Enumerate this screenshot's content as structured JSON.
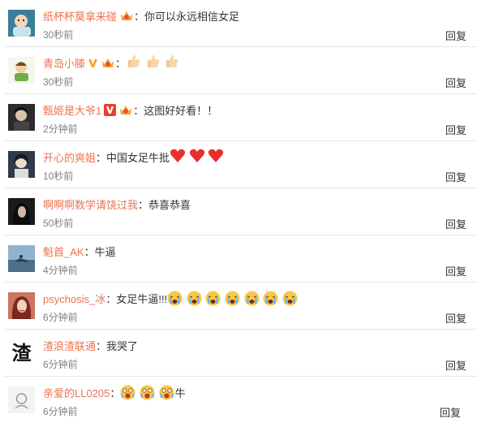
{
  "comments": [
    {
      "name": "纸杯杯莫拿来碰",
      "text": "你可以永远相信女足",
      "time": "30秒前"
    },
    {
      "name": "青岛小滕",
      "text": "",
      "time": "30秒前"
    },
    {
      "name": "甄姬是大爷1",
      "text": "这图好好看！！",
      "time": "2分钟前"
    },
    {
      "name": "开心的爽姐",
      "text": "中国女足牛批",
      "time": "10秒前"
    },
    {
      "name": "啊啊啊数学请饶过我",
      "text": "恭喜恭喜",
      "time": "50秒前"
    },
    {
      "name": "魁首_AK",
      "text": "牛逼",
      "time": "4分钟前"
    },
    {
      "name": "psychosis_冰",
      "text": "女足牛逼!!!",
      "time": "6分钟前"
    },
    {
      "name": "渣浪渣联通",
      "text": "我哭了",
      "time": "6分钟前"
    },
    {
      "name": "亲爱的LL0205",
      "text": "牛",
      "time": "6分钟前"
    }
  ],
  "common": {
    "colon": "：",
    "reply_label": "回复"
  },
  "avatar_glyphs": {
    "c7": "渣"
  },
  "colors": {
    "name": "#eb7350",
    "text": "#333333",
    "time": "#808080",
    "divider": "#e6e6e6"
  }
}
